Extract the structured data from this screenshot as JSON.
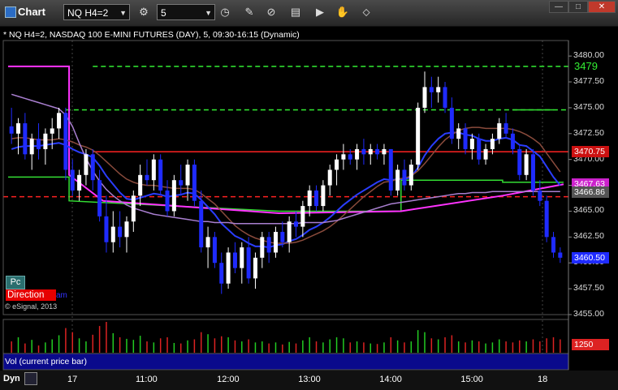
{
  "window": {
    "title": "Chart",
    "symbol_value": "NQ H4=2",
    "interval_value": "5",
    "min_label": "—",
    "max_label": "□",
    "close_label": "✕"
  },
  "chart_header": "* NQ H4=2, NASDAQ 100 E-MINI FUTURES (DAY), 5, 09:30-16:15 (Dynamic)",
  "legend": {
    "pc_label": "Pc",
    "direction_label": "Direction",
    "direction_suffix": "am",
    "copyright": "© eSignal, 2013"
  },
  "volume_label": "Vol (current price bar)",
  "volume_badge": "1250",
  "dyn_label": "Dyn",
  "colors": {
    "background": "#000000",
    "up_candle": "#ffffff",
    "down_candle": "#1f2bff",
    "ma_blue": "#2a3dff",
    "ma_brown": "#8a4b3c",
    "ma_purple": "#a97fd0",
    "magenta": "#ff33ff",
    "green_line": "#33dd33",
    "red_level": "#ff2222",
    "green_dashed": "#33ee33",
    "volume_up": "#22cc22",
    "volume_down": "#dd2222",
    "tdseq_yellow": "#ffff44",
    "tdseq_green": "#33cc33",
    "tdseq_cyan": "#33eeff"
  },
  "chart_data": {
    "type": "candlestick",
    "title": "* NQ H4=2, NASDAQ 100 E-MINI FUTURES (DAY), 5, 09:30-16:15 (Dynamic)",
    "ylim": [
      3455.0,
      3481.5
    ],
    "y_ticks": [
      3480.0,
      3477.5,
      3475.0,
      3472.5,
      3470.0,
      3467.5,
      3465.0,
      3462.5,
      3460.0,
      3457.5,
      3455.0
    ],
    "y_tick_labels": [
      "3480.00",
      "3477.50",
      "3475.00",
      "3472.50",
      "3470.00",
      "3467.50",
      "3465.00",
      "3462.50",
      "3460.00",
      "3457.50",
      "3455.00"
    ],
    "x_tick_labels": [
      "17",
      "11:00",
      "12:00",
      "13:00",
      "14:00",
      "15:00",
      "18"
    ],
    "price_badges": [
      {
        "label": "3479",
        "value": 3479.0,
        "color": "#33ee33",
        "bg": "#000000"
      },
      {
        "label": "3470.75",
        "value": 3470.75,
        "color": "#ffffff",
        "bg": "#cc1111"
      },
      {
        "label": "3467.63",
        "value": 3467.63,
        "color": "#ffffff",
        "bg": "#cc22cc"
      },
      {
        "label": "3466.86",
        "value": 3466.86,
        "color": "#ffffff",
        "bg": "#555555"
      },
      {
        "label": "3460.50",
        "value": 3460.5,
        "color": "#ffffff",
        "bg": "#1f2bff"
      }
    ],
    "levels": [
      {
        "name": "3479",
        "value": 3479.0,
        "style": "dashed",
        "color": "#33ee33",
        "from": 12,
        "to": 95
      },
      {
        "name": "dashed-green-mid",
        "value": 3474.8,
        "style": "dashed",
        "color": "#33ee33",
        "from": 8,
        "to": 72
      },
      {
        "name": "3470.75",
        "value": 3470.75,
        "style": "solid",
        "color": "#ff2222",
        "from": 12,
        "to": 95
      },
      {
        "name": "dashed-red",
        "value": 3466.4,
        "style": "dashed",
        "color": "#ff2222",
        "from": 0,
        "to": 95
      }
    ],
    "candles": [
      [
        3473.2,
        3475.0,
        3471.5,
        3472.5
      ],
      [
        3472.5,
        3474.0,
        3470.5,
        3473.5
      ],
      [
        3473.5,
        3474.5,
        3470.0,
        3470.5
      ],
      [
        3470.5,
        3472.5,
        3469.0,
        3472.0
      ],
      [
        3472.0,
        3473.5,
        3470.0,
        3471.0
      ],
      [
        3471.0,
        3473.0,
        3469.5,
        3472.5
      ],
      [
        3472.5,
        3474.0,
        3471.0,
        3473.0
      ],
      [
        3473.0,
        3475.0,
        3472.0,
        3474.5
      ],
      [
        3474.5,
        3475.0,
        3468.0,
        3469.0
      ],
      [
        3469.0,
        3470.0,
        3466.5,
        3467.0
      ],
      [
        3467.0,
        3469.0,
        3466.0,
        3468.5
      ],
      [
        3468.5,
        3471.0,
        3467.5,
        3470.5
      ],
      [
        3470.5,
        3471.0,
        3467.0,
        3468.0
      ],
      [
        3468.0,
        3469.0,
        3464.0,
        3464.5
      ],
      [
        3464.5,
        3466.5,
        3461.0,
        3462.0
      ],
      [
        3462.0,
        3465.0,
        3461.0,
        3463.5
      ],
      [
        3463.5,
        3465.0,
        3461.5,
        3462.5
      ],
      [
        3462.5,
        3464.5,
        3461.0,
        3464.0
      ],
      [
        3464.0,
        3467.0,
        3463.0,
        3466.5
      ],
      [
        3466.5,
        3469.5,
        3465.5,
        3468.5
      ],
      [
        3468.5,
        3470.0,
        3467.5,
        3468.0
      ],
      [
        3468.0,
        3470.5,
        3467.0,
        3470.0
      ],
      [
        3470.0,
        3470.5,
        3466.5,
        3467.0
      ],
      [
        3467.0,
        3468.0,
        3464.5,
        3465.0
      ],
      [
        3465.0,
        3468.5,
        3464.5,
        3468.0
      ],
      [
        3468.0,
        3469.5,
        3466.5,
        3467.5
      ],
      [
        3467.5,
        3470.0,
        3466.0,
        3469.5
      ],
      [
        3469.5,
        3470.0,
        3465.5,
        3466.0
      ],
      [
        3466.0,
        3467.0,
        3461.0,
        3461.5
      ],
      [
        3461.5,
        3463.5,
        3459.5,
        3462.5
      ],
      [
        3462.5,
        3463.0,
        3459.5,
        3460.0
      ],
      [
        3460.0,
        3461.0,
        3457.0,
        3458.0
      ],
      [
        3458.0,
        3461.5,
        3457.5,
        3461.0
      ],
      [
        3461.0,
        3462.0,
        3459.0,
        3459.5
      ],
      [
        3459.5,
        3462.0,
        3458.0,
        3461.5
      ],
      [
        3461.5,
        3462.5,
        3458.0,
        3458.5
      ],
      [
        3458.5,
        3461.0,
        3457.5,
        3460.5
      ],
      [
        3460.5,
        3463.0,
        3459.5,
        3462.5
      ],
      [
        3462.5,
        3463.0,
        3460.0,
        3461.0
      ],
      [
        3461.0,
        3463.5,
        3460.5,
        3463.0
      ],
      [
        3463.0,
        3464.0,
        3461.5,
        3462.0
      ],
      [
        3462.0,
        3464.5,
        3461.0,
        3464.0
      ],
      [
        3464.0,
        3465.0,
        3462.5,
        3463.5
      ],
      [
        3463.5,
        3466.0,
        3462.5,
        3465.5
      ],
      [
        3465.5,
        3467.5,
        3464.5,
        3467.0
      ],
      [
        3467.0,
        3467.5,
        3465.0,
        3465.5
      ],
      [
        3465.5,
        3468.0,
        3465.0,
        3467.5
      ],
      [
        3467.5,
        3469.5,
        3466.5,
        3469.0
      ],
      [
        3469.0,
        3470.5,
        3467.5,
        3470.0
      ],
      [
        3470.0,
        3471.5,
        3469.0,
        3470.5
      ],
      [
        3470.5,
        3471.0,
        3469.5,
        3470.0
      ],
      [
        3470.0,
        3471.5,
        3469.0,
        3471.0
      ],
      [
        3471.0,
        3472.0,
        3469.5,
        3470.5
      ],
      [
        3470.5,
        3471.5,
        3469.5,
        3471.0
      ],
      [
        3471.0,
        3471.5,
        3470.0,
        3470.5
      ],
      [
        3470.5,
        3471.5,
        3469.5,
        3471.0
      ],
      [
        3471.0,
        3471.0,
        3466.5,
        3467.0
      ],
      [
        3467.0,
        3469.5,
        3466.5,
        3469.0
      ],
      [
        3469.0,
        3470.0,
        3467.0,
        3467.5
      ],
      [
        3467.5,
        3470.0,
        3467.0,
        3469.5
      ],
      [
        3469.5,
        3475.5,
        3469.0,
        3475.0
      ],
      [
        3475.0,
        3478.5,
        3474.5,
        3477.0
      ],
      [
        3477.0,
        3478.0,
        3475.0,
        3476.5
      ],
      [
        3476.5,
        3478.0,
        3475.5,
        3477.0
      ],
      [
        3477.0,
        3477.5,
        3474.5,
        3475.0
      ],
      [
        3475.0,
        3476.0,
        3471.5,
        3472.0
      ],
      [
        3472.0,
        3473.5,
        3471.0,
        3473.0
      ],
      [
        3473.0,
        3473.5,
        3470.5,
        3471.0
      ],
      [
        3471.0,
        3472.5,
        3470.0,
        3472.0
      ],
      [
        3472.0,
        3472.5,
        3469.5,
        3470.0
      ],
      [
        3470.0,
        3471.5,
        3469.5,
        3471.0
      ],
      [
        3471.0,
        3472.5,
        3470.5,
        3472.0
      ],
      [
        3472.0,
        3474.0,
        3471.5,
        3473.5
      ],
      [
        3473.5,
        3474.5,
        3472.0,
        3472.5
      ],
      [
        3472.5,
        3473.0,
        3470.5,
        3471.0
      ],
      [
        3471.0,
        3471.5,
        3468.0,
        3468.5
      ],
      [
        3468.5,
        3471.0,
        3468.0,
        3470.5
      ],
      [
        3470.5,
        3471.0,
        3466.5,
        3467.0
      ],
      [
        3467.0,
        3468.0,
        3465.5,
        3466.0
      ],
      [
        3466.0,
        3466.5,
        3462.0,
        3462.5
      ],
      [
        3462.5,
        3463.0,
        3460.5,
        3461.0
      ],
      [
        3461.0,
        3461.5,
        3460.0,
        3460.5
      ]
    ],
    "series": [
      {
        "name": "",
        "color": "#2a3dff",
        "values": [
          3471.0,
          3471.2,
          3471.3,
          3471.3,
          3471.3,
          3471.4,
          3471.5,
          3471.6,
          3471.4,
          3471.0,
          3470.7,
          3470.5,
          3470.2,
          3469.4,
          3468.4,
          3467.6,
          3466.8,
          3466.2,
          3466.1,
          3466.3,
          3466.5,
          3466.7,
          3466.6,
          3466.4,
          3466.5,
          3466.6,
          3466.8,
          3466.7,
          3466.1,
          3465.4,
          3464.7,
          3463.8,
          3463.2,
          3462.6,
          3462.3,
          3461.9,
          3461.6,
          3461.6,
          3461.5,
          3461.7,
          3461.8,
          3462.1,
          3462.3,
          3462.7,
          3463.2,
          3463.5,
          3463.9,
          3464.4,
          3465.0,
          3465.6,
          3466.1,
          3466.6,
          3467.0,
          3467.4,
          3467.8,
          3468.1,
          3468.0,
          3468.1,
          3468.1,
          3468.3,
          3469.2,
          3470.4,
          3471.3,
          3472.0,
          3472.5,
          3472.6,
          3472.6,
          3472.4,
          3472.3,
          3472.0,
          3471.8,
          3471.8,
          3472.0,
          3472.1,
          3471.9,
          3471.4,
          3471.3,
          3470.8,
          3470.3,
          3469.3,
          3468.3,
          3467.5
        ]
      },
      {
        "name": "",
        "color": "#8a4b3c",
        "values": [
          3472.0,
          3472.1,
          3472.1,
          3472.0,
          3471.9,
          3471.9,
          3471.9,
          3472.0,
          3471.9,
          3471.7,
          3471.4,
          3471.2,
          3470.9,
          3470.4,
          3469.8,
          3469.2,
          3468.6,
          3468.1,
          3467.8,
          3467.6,
          3467.5,
          3467.5,
          3467.4,
          3467.3,
          3467.2,
          3467.2,
          3467.2,
          3467.1,
          3466.7,
          3466.2,
          3465.7,
          3465.0,
          3464.3,
          3463.6,
          3463.1,
          3462.7,
          3462.4,
          3462.2,
          3462.0,
          3461.9,
          3461.9,
          3461.9,
          3462.0,
          3462.2,
          3462.5,
          3462.8,
          3463.1,
          3463.5,
          3464.0,
          3464.6,
          3465.2,
          3465.8,
          3466.4,
          3466.9,
          3467.4,
          3467.8,
          3467.9,
          3468.1,
          3468.2,
          3468.4,
          3468.9,
          3469.6,
          3470.4,
          3471.2,
          3471.9,
          3472.4,
          3472.8,
          3473.0,
          3473.1,
          3473.1,
          3473.0,
          3473.0,
          3473.0,
          3473.0,
          3472.9,
          3472.7,
          3472.4,
          3472.0,
          3471.5,
          3470.6,
          3469.7,
          3468.8
        ]
      },
      {
        "name": "",
        "color": "#a97fd0",
        "values": [
          3476.3,
          3476.1,
          3475.9,
          3475.7,
          3475.5,
          3475.3,
          3475.1,
          3474.9,
          3474.3,
          3473.2,
          3471.6,
          3470.1,
          3468.9,
          3467.9,
          3467.1,
          3466.5,
          3466.0,
          3465.6,
          3465.3,
          3465.1,
          3464.9,
          3464.7,
          3464.6,
          3464.5,
          3464.4,
          3464.3,
          3464.2,
          3464.1,
          3464.0,
          3464.0,
          3463.9,
          3463.9,
          3463.9,
          3463.8,
          3463.8,
          3463.8,
          3463.8,
          3463.8,
          3463.8,
          3463.8,
          3463.8,
          3463.8,
          3463.8,
          3463.9,
          3463.9,
          3463.9,
          3463.9,
          3464.0,
          3464.1,
          3464.3,
          3464.5,
          3464.7,
          3464.9,
          3465.1,
          3465.3,
          3465.5,
          3465.7,
          3465.8,
          3465.9,
          3466.0,
          3466.1,
          3466.2,
          3466.3,
          3466.4,
          3466.5,
          3466.6,
          3466.7,
          3466.7,
          3466.8,
          3466.8,
          3466.8,
          3466.9,
          3466.9,
          3466.9,
          3466.9,
          3466.9,
          3466.9,
          3466.9,
          3466.9,
          3466.9,
          3466.9,
          3466.9
        ]
      }
    ],
    "volume": [
      22,
      30,
      18,
      25,
      14,
      20,
      26,
      34,
      48,
      40,
      28,
      22,
      35,
      52,
      60,
      38,
      30,
      27,
      25,
      33,
      22,
      20,
      28,
      30,
      19,
      18,
      24,
      26,
      40,
      36,
      28,
      32,
      30,
      24,
      22,
      26,
      20,
      22,
      18,
      20,
      16,
      21,
      18,
      24,
      30,
      22,
      20,
      26,
      30,
      28,
      20,
      22,
      20,
      18,
      17,
      20,
      30,
      24,
      20,
      22,
      44,
      40,
      28,
      26,
      30,
      34,
      22,
      20,
      24,
      22,
      18,
      20,
      26,
      22,
      20,
      24,
      22,
      26,
      22,
      28,
      30,
      26
    ]
  }
}
